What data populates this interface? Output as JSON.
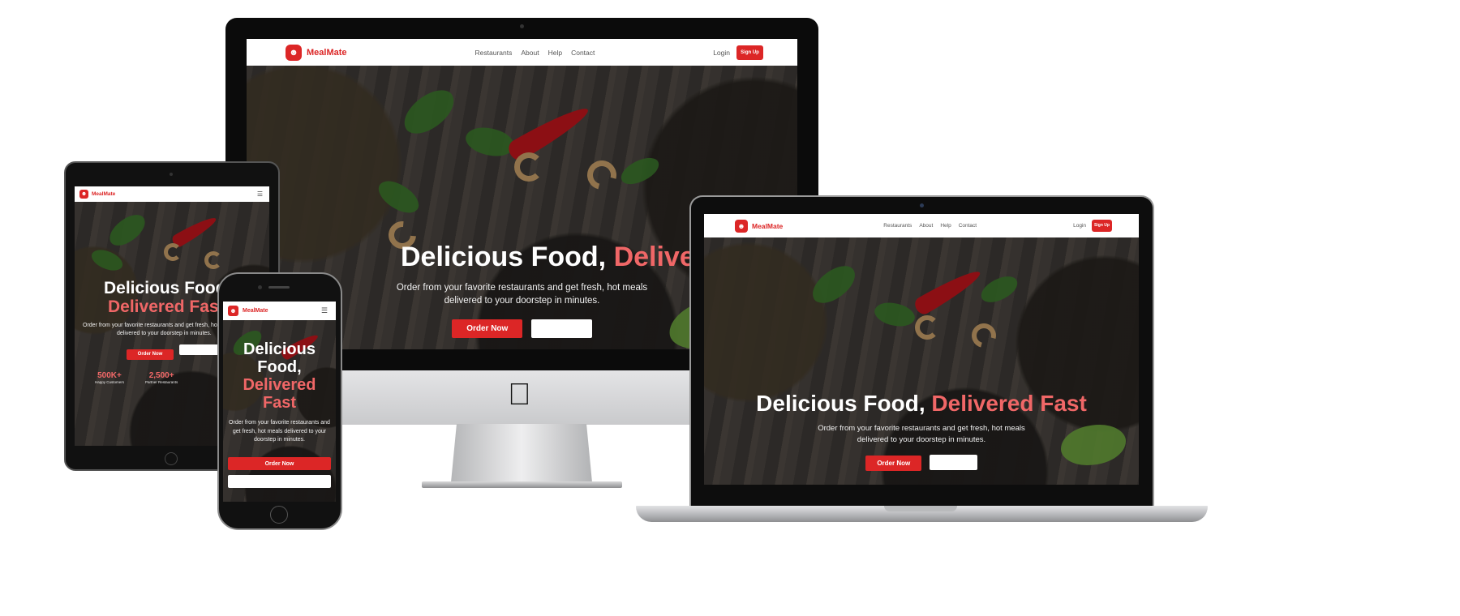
{
  "brand": {
    "name": "MealMate",
    "logo_icon": "chef-icon",
    "accent": "#dc2626",
    "highlight": "#f06767"
  },
  "nav": {
    "links": [
      "Restaurants",
      "About",
      "Help",
      "Contact"
    ],
    "login": "Login",
    "signup": "Sign Up",
    "menu_icon": "hamburger-icon"
  },
  "hero": {
    "title_white": "Delicious Food,",
    "title_red": "Delivered Fast",
    "subtitle_line1": "Order from your favorite restaurants and get fresh, hot meals",
    "subtitle_line2": "delivered to your doorstep in minutes.",
    "primary_cta": "Order Now",
    "secondary_cta": ""
  },
  "stats": [
    {
      "value": "500K+",
      "label": "Happy Customers"
    },
    {
      "value": "2,500+",
      "label": "Partner Restaurants"
    }
  ],
  "devices": {
    "desktop_logo_icon": "apple-icon"
  }
}
